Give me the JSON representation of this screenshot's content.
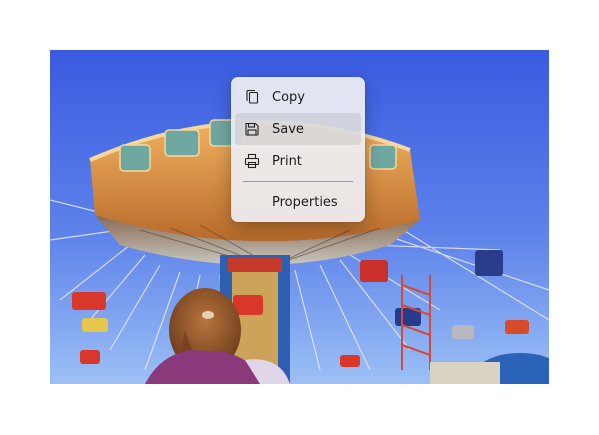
{
  "context_menu": {
    "items": [
      {
        "label": "Copy",
        "icon": "copy-icon",
        "highlighted": false
      },
      {
        "label": "Save",
        "icon": "save-icon",
        "highlighted": true
      },
      {
        "label": "Print",
        "icon": "print-icon",
        "highlighted": false
      }
    ],
    "secondary_items": [
      {
        "label": "Properties"
      }
    ]
  },
  "colors": {
    "sky_top": "#3d5fe0",
    "sky_bottom": "#8eb2f2",
    "menu_bg": "#eeeef2",
    "menu_highlight": "#dcdce0",
    "canopy_orange": "#d9823a"
  }
}
